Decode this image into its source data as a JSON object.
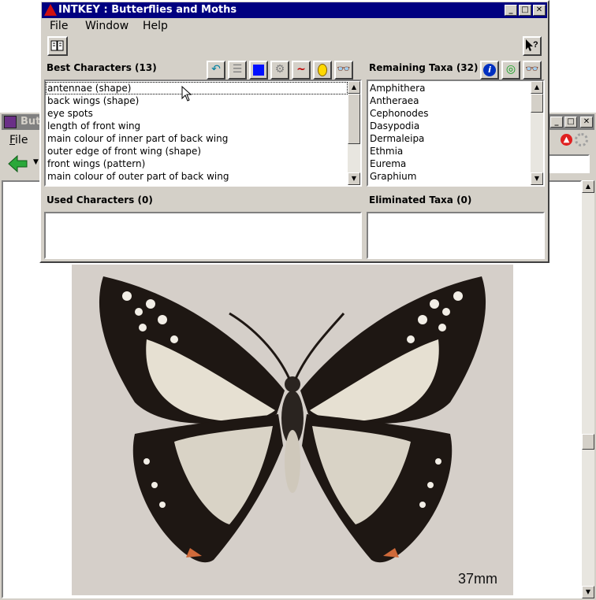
{
  "main_window": {
    "title": "INTKEY : Butterflies and Moths",
    "menu": [
      "File",
      "Window",
      "Help"
    ]
  },
  "best_characters": {
    "title": "Best Characters (13)",
    "items": [
      "antennae (shape)",
      "back wings (shape)",
      "eye spots",
      "length of front wing",
      "main colour of inner part of back wing",
      "outer edge of front wing (shape)",
      "front wings (pattern)",
      "main colour of outer part of back wing"
    ]
  },
  "remaining_taxa": {
    "title": "Remaining Taxa (32)",
    "items": [
      "Amphithera",
      "Antheraea",
      "Cephonodes",
      "Dasypodia",
      "Dermaleipa",
      "Ethmia",
      "Eurema",
      "Graphium"
    ]
  },
  "used_characters": {
    "title": "Used Characters (0)"
  },
  "eliminated_taxa": {
    "title": "Eliminated Taxa (0)"
  },
  "background_window": {
    "title": "Butt",
    "menu_file": "File"
  },
  "image": {
    "scale_label": "37mm"
  }
}
